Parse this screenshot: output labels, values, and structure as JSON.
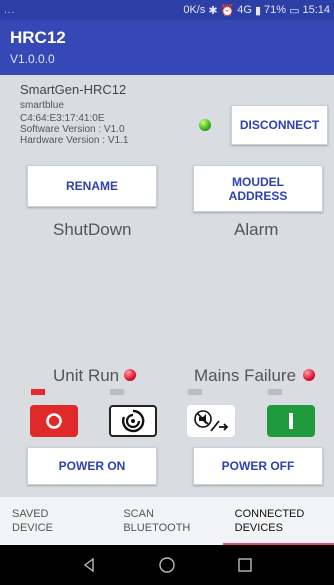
{
  "status_bar": {
    "left": "...",
    "speed": "0K/s",
    "signal": "4G",
    "battery": "71%",
    "time": "15:14"
  },
  "app": {
    "title": "HRC12",
    "version": "V1.0.0.0"
  },
  "device": {
    "name": "SmartGen-HRC12",
    "brand": "smartblue",
    "mac": "C4:64:E3:17:41:0E",
    "software_version": "Software Version : V1.0",
    "hardware_version": "Hardware Version : V1.1",
    "connected": true
  },
  "buttons": {
    "disconnect": "DISCONNECT",
    "rename": "RENAME",
    "modbus_address": "MOUDEL\nADDRESS",
    "power_on": "POWER ON",
    "power_off": "POWER OFF"
  },
  "labels": {
    "shutdown": "ShutDown",
    "alarm": "Alarm",
    "unit_run": "Unit Run",
    "mains_failure": "Mains Failure"
  },
  "controls": [
    {
      "name": "stop",
      "icon": "stop-icon",
      "indicator_on": true
    },
    {
      "name": "auto",
      "icon": "auto-icon",
      "indicator_on": false
    },
    {
      "name": "mute-reset",
      "icon": "mute-reset-icon",
      "indicator_on": false
    },
    {
      "name": "start",
      "icon": "start-icon",
      "indicator_on": false
    }
  ],
  "colors": {
    "primary": "#3548b5",
    "accent": "#e34a7c",
    "stop": "#e02a2a",
    "start": "#1f9a3c"
  },
  "tabs": [
    {
      "label": "SAVED\nDEVICE",
      "active": false
    },
    {
      "label": "SCAN\nBLUETOOTH",
      "active": false
    },
    {
      "label": "CONNECTED\nDEVICES",
      "active": true
    }
  ]
}
